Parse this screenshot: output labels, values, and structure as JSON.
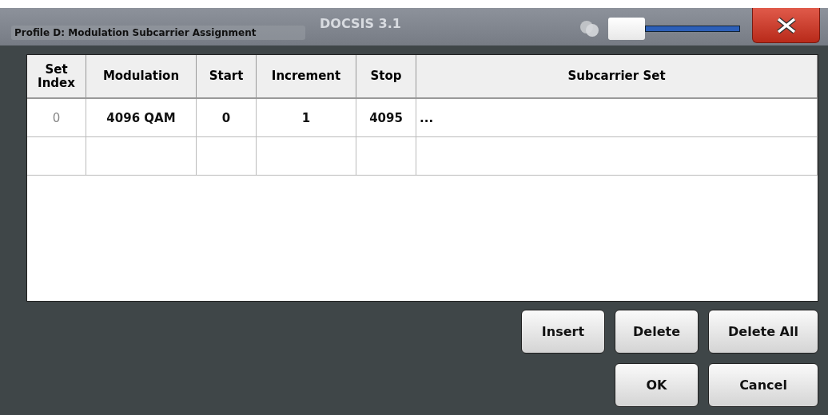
{
  "background_tabs": [
    {
      "label": "DOCSIS 3.1"
    }
  ],
  "dialog": {
    "title": "Profile D: Modulation Subcarrier Assignment",
    "transparency": {
      "level": 0
    }
  },
  "table": {
    "columns": [
      "Set Index",
      "Modulation",
      "Start",
      "Increment",
      "Stop",
      "Subcarrier Set"
    ],
    "rows": [
      {
        "cells": [
          "0",
          "4096 QAM",
          "0",
          "1",
          "4095",
          "..."
        ]
      }
    ]
  },
  "button_rows": [
    [
      {
        "label": "Insert"
      },
      {
        "label": "Delete"
      },
      {
        "label": "Delete All"
      }
    ],
    [
      {
        "label": "OK"
      },
      {
        "label": "Cancel"
      }
    ]
  ]
}
